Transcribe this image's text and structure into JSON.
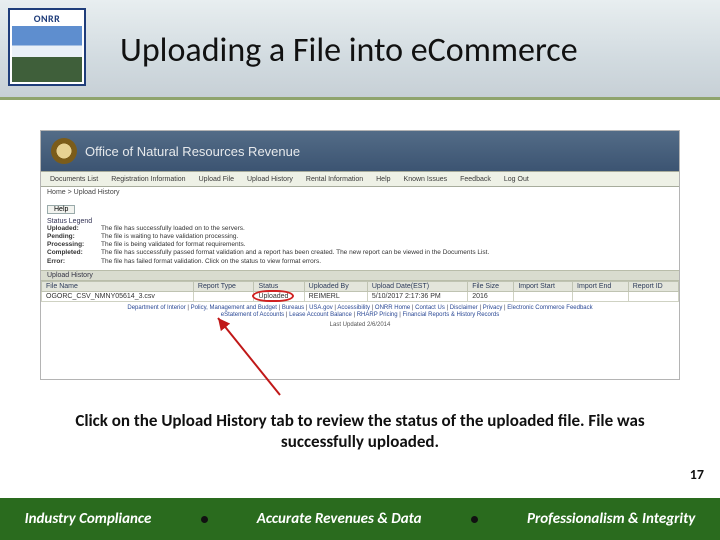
{
  "logo": {
    "text": "ONRR"
  },
  "title": "Uploading a File into eCommerce",
  "screenshot": {
    "banner_title": "Office of Natural Resources Revenue",
    "tabs": [
      "Documents List",
      "Registration Information",
      "Upload File",
      "Upload History",
      "Rental Information",
      "Help",
      "Known Issues",
      "Feedback",
      "Log Out"
    ],
    "breadcrumb": "Home > Upload History",
    "help_label": "Help",
    "legend_title": "Status Legend",
    "legend": {
      "Uploaded": "The file has successfully loaded on to the servers.",
      "Pending": "The file is waiting to have validation processing.",
      "Processing": "The file is being validated for format requirements.",
      "Completed": "The file has successfully passed format validation and a report has been created. The new report can be viewed in the Documents List.",
      "Error": "The file has failed format validation. Click on the status to view format errors."
    },
    "section_label": "Upload History",
    "columns": [
      "File Name",
      "Report Type",
      "Status",
      "Uploaded By",
      "Upload Date(EST)",
      "File Size",
      "Import Start",
      "Import End",
      "Report ID"
    ],
    "row": {
      "file_name": "OGORC_CSV_NMNY05614_3.csv",
      "report_type": "",
      "status": "Uploaded",
      "uploaded_by": "REIMERL",
      "upload_date": "5/10/2017 2:17:36 PM",
      "file_size": "2016",
      "import_start": "",
      "import_end": "",
      "report_id": ""
    },
    "footer_line1_parts": [
      "Department of Interior",
      "Policy, Management and Budget",
      "Bureaus",
      "USA.gov",
      "Accessibility",
      "ONRR Home",
      "Contact Us",
      "Disclaimer",
      "Privacy",
      "Electronic Commerce Feedback"
    ],
    "footer_line2_parts": [
      "eStatement of Accounts",
      "Lease Account Balance",
      "RHARP Pricing",
      "Financial Reports & History Records"
    ],
    "last_updated": "Last Updated 2/6/2014"
  },
  "caption": "Click on the Upload History tab to review the status of the uploaded file. File was successfully uploaded.",
  "page_number": "17",
  "footer": {
    "left": "Industry Compliance",
    "mid": "Accurate Revenues & Data",
    "right": "Professionalism & Integrity"
  }
}
